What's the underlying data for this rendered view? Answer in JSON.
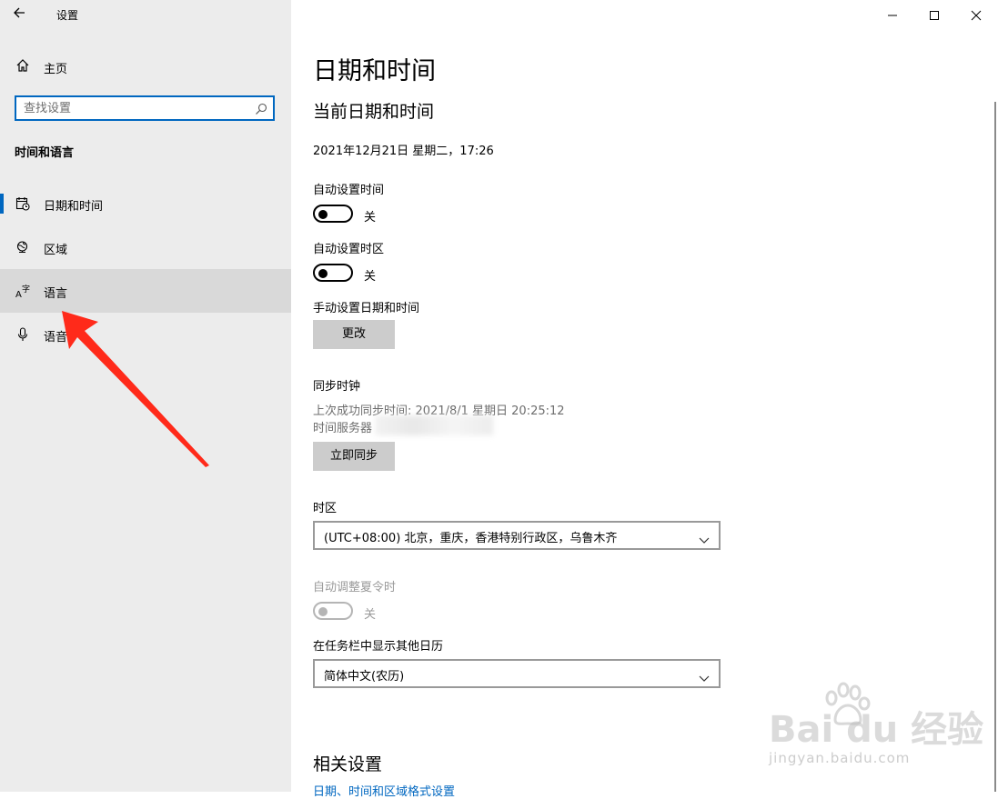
{
  "window": {
    "title": "设置"
  },
  "sidebar": {
    "home_label": "主页",
    "search_placeholder": "查找设置",
    "section_title": "时间和语言",
    "items": [
      {
        "label": "日期和时间",
        "icon": "calendar-clock-icon",
        "active": true
      },
      {
        "label": "区域",
        "icon": "globe-icon"
      },
      {
        "label": "语言",
        "icon": "language-icon",
        "hover": true
      },
      {
        "label": "语音",
        "icon": "microphone-icon"
      }
    ]
  },
  "main": {
    "page_title": "日期和时间",
    "sub_title": "当前日期和时间",
    "current_datetime": "2021年12月21日 星期二，17:26",
    "auto_time": {
      "label": "自动设置时间",
      "state": "关"
    },
    "auto_timezone": {
      "label": "自动设置时区",
      "state": "关"
    },
    "manual": {
      "label": "手动设置日期和时间",
      "button": "更改"
    },
    "sync": {
      "title": "同步时钟",
      "last_sync": "上次成功同步时间: 2021/8/1 星期日 20:25:12",
      "server_label": "时间服务器",
      "button": "立即同步"
    },
    "timezone": {
      "label": "时区",
      "value": "(UTC+08:00) 北京，重庆，香港特别行政区，乌鲁木齐"
    },
    "dst": {
      "label": "自动调整夏令时",
      "state": "关"
    },
    "calendar": {
      "label": "在任务栏中显示其他日历",
      "value": "简体中文(农历)"
    },
    "related": {
      "title": "相关设置",
      "link": "日期、时间和区域格式设置"
    }
  },
  "watermark": {
    "text": "Bai du 经验",
    "sub": "jingyan.baidu.com"
  },
  "colors": {
    "accent": "#0067c0",
    "arrow": "#ff2a1a",
    "sidebar_bg": "#ececec"
  }
}
